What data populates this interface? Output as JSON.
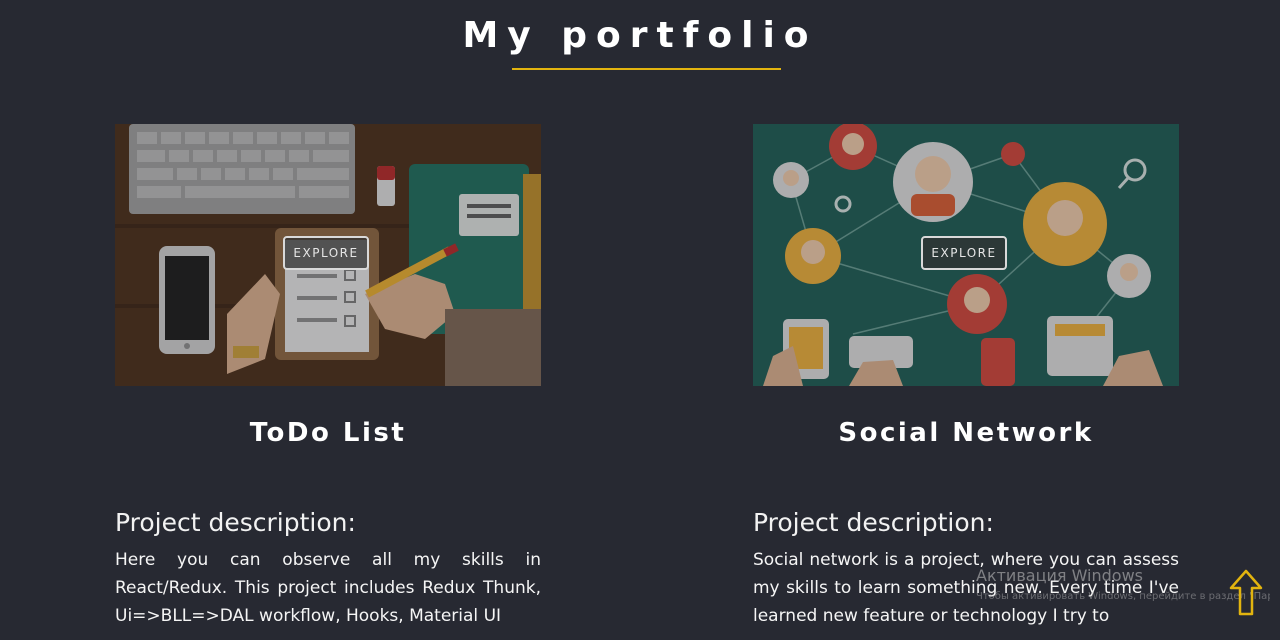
{
  "header": {
    "title": "My portfolio"
  },
  "projects": [
    {
      "name": "ToDo List",
      "explore_label": "EXPLORE",
      "description_heading": "Project description:",
      "description": "Here you can observe all my skills in React/Redux. This project includes Redux Thunk, Ui=>BLL=>DAL workflow, Hooks, Material UI"
    },
    {
      "name": "Social Network",
      "explore_label": "EXPLORE",
      "description_heading": "Project description:",
      "description": "Social network is a project, where you can assess my skills to learn something new. Every time I've learned new feature or technology I try to"
    }
  ],
  "overlay": {
    "windows_activation": "Активация Windows",
    "windows_activation_hint": "Чтобы активировать Windows, перейдите в раздел \"Параметры\"."
  },
  "colors": {
    "background": "#272932",
    "accent": "#e2b40f",
    "text": "#ffffff"
  },
  "icons": {
    "scroll_top": "arrow-up-icon"
  }
}
